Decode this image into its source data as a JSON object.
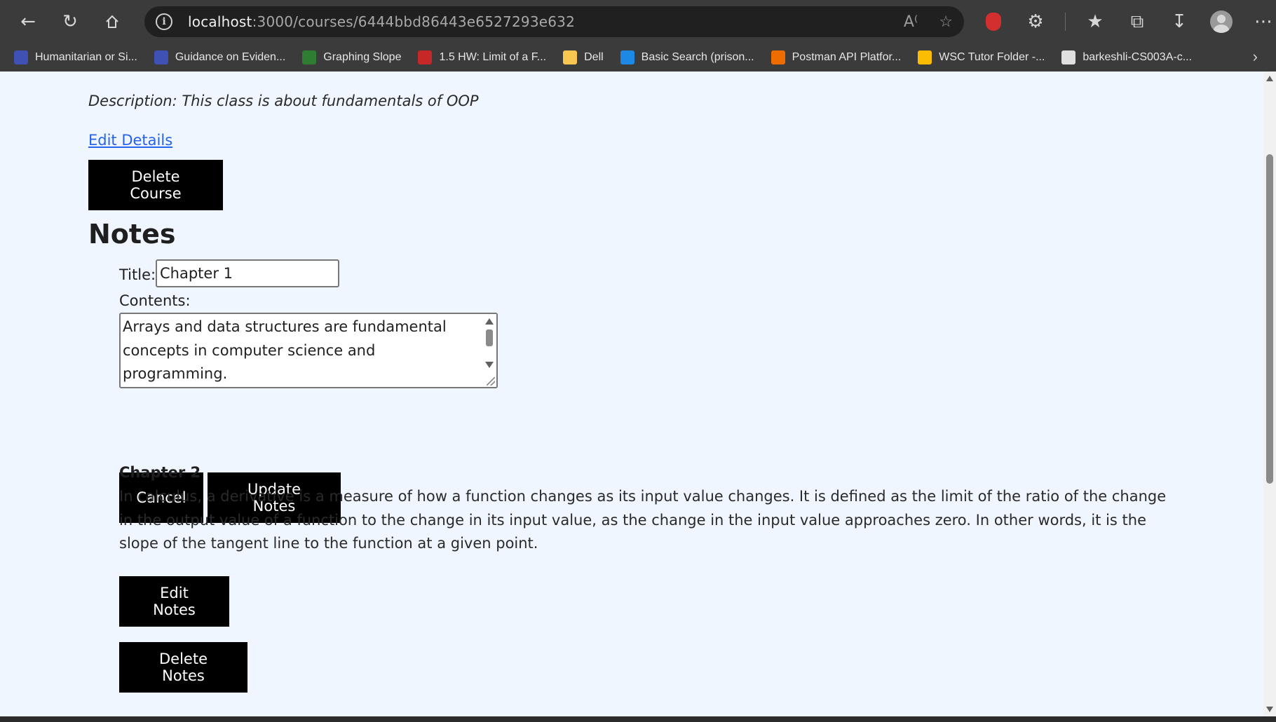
{
  "browser": {
    "url_host": "localhost",
    "url_path": ":3000/courses/6444bbd86443e6527293e632",
    "bookmarks": [
      {
        "label": "Humanitarian or Si...",
        "color": "#3f51b5"
      },
      {
        "label": "Guidance on Eviden...",
        "color": "#3f51b5"
      },
      {
        "label": "Graphing Slope",
        "color": "#2e7d32"
      },
      {
        "label": "1.5 HW: Limit of a F...",
        "color": "#c62828"
      },
      {
        "label": "Dell",
        "color": "#f9c74f"
      },
      {
        "label": "Basic Search (prison...",
        "color": "#1e88e5"
      },
      {
        "label": "Postman API Platfor...",
        "color": "#ef6c00"
      },
      {
        "label": "WSC Tutor Folder -...",
        "color": "#fbbc04"
      },
      {
        "label": "barkeshli-CS003A-c...",
        "color": "#e0e0e0"
      }
    ]
  },
  "course": {
    "description": "Description: This class is about fundamentals of OOP",
    "edit_details_label": "Edit Details",
    "delete_course_label": "Delete Course"
  },
  "notes": {
    "heading": "Notes",
    "form": {
      "title_label": "Title:",
      "title_value": "Chapter 1",
      "contents_label": "Contents:",
      "contents_value": "Arrays and data structures are fundamental\nconcepts in computer science and programming.\nAn array is a collection of elements, each identified",
      "cancel_label": "Cancel",
      "update_label": "Update Notes"
    },
    "items": [
      {
        "title": "Chapter 2",
        "text": "In calculus, a derivative is a measure of how a function changes as its input value changes. It is defined as the limit of the ratio of the change in the output value of a function to the change in its input value, as the change in the input value approaches zero. In other words, it is the slope of the tangent line to the function at a given point.",
        "edit_label": "Edit Notes",
        "delete_label": "Delete Notes"
      }
    ]
  }
}
